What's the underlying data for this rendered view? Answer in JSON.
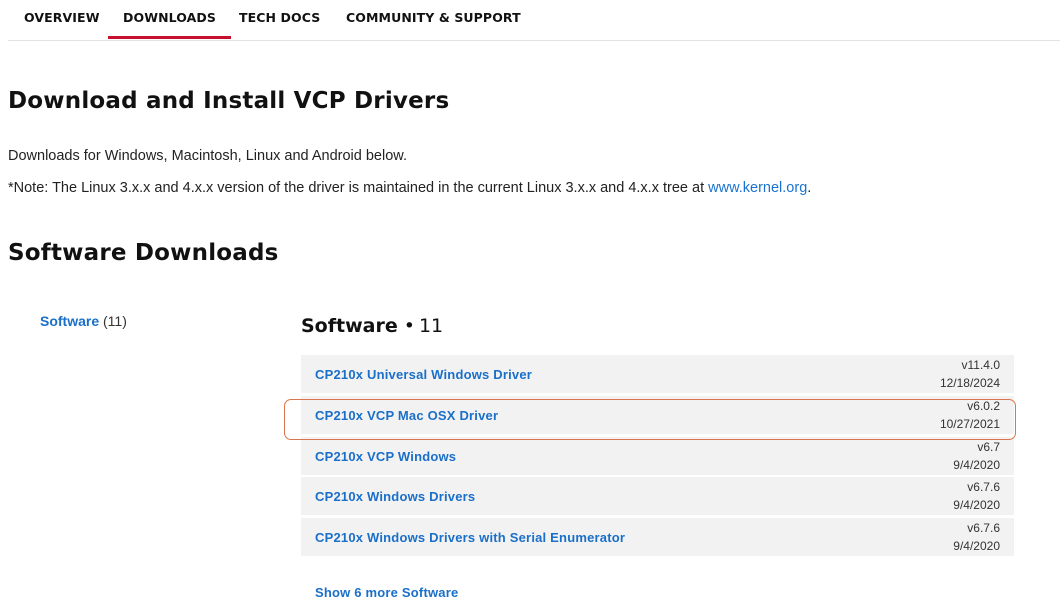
{
  "tabs": [
    {
      "label": "OVERVIEW"
    },
    {
      "label": "DOWNLOADS",
      "active": true
    },
    {
      "label": "TECH DOCS"
    },
    {
      "label": "COMMUNITY & SUPPORT"
    }
  ],
  "page_title": "Download and Install VCP Drivers",
  "intro": "Downloads for Windows, Macintosh, Linux and Android below.",
  "note": {
    "text": "*Note: The Linux 3.x.x and 4.x.x version of the driver is maintained in the current Linux 3.x.x and 4.x.x tree at ",
    "link": "www.kernel.org",
    "suffix": "."
  },
  "section_title": "Software Downloads",
  "filter": {
    "label": "Software",
    "count": "(11)"
  },
  "list_heading": {
    "label": "Software",
    "separator": "•",
    "count": "11"
  },
  "software": [
    {
      "name": "CP210x Universal Windows Driver",
      "version": "v11.4.0",
      "date": "12/18/2024"
    },
    {
      "name": "CP210x VCP Mac OSX Driver",
      "version": "v6.0.2",
      "date": "10/27/2021",
      "highlighted": true
    },
    {
      "name": "CP210x VCP Windows",
      "version": "v6.7",
      "date": "9/4/2020"
    },
    {
      "name": "CP210x Windows Drivers",
      "version": "v6.7.6",
      "date": "9/4/2020"
    },
    {
      "name": "CP210x Windows Drivers with Serial Enumerator",
      "version": "v6.7.6",
      "date": "9/4/2020"
    }
  ],
  "show_more": "Show 6 more Software",
  "colors": {
    "accent_red": "#c8102e",
    "link_blue": "#1a6fc9",
    "highlight_border": "#d9764e",
    "row_bg": "#f2f2f2"
  }
}
